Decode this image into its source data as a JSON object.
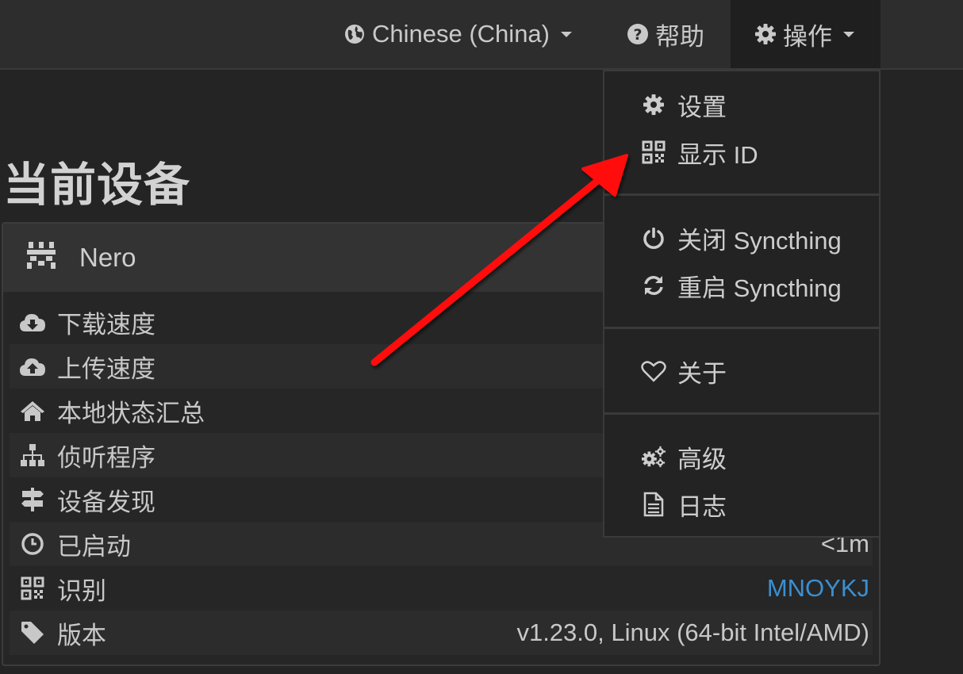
{
  "navbar": {
    "language": "Chinese (China)",
    "help": "帮助",
    "actions": "操作"
  },
  "page": {
    "title": "当前设备"
  },
  "device": {
    "name": "Nero",
    "rows": [
      {
        "icon": "cloud-download-icon",
        "label": "下载速度",
        "value": ""
      },
      {
        "icon": "cloud-upload-icon",
        "label": "上传速度",
        "value": ""
      },
      {
        "icon": "home-icon",
        "label": "本地状态汇总",
        "value": ""
      },
      {
        "icon": "sitemap-icon",
        "label": "侦听程序",
        "value": ""
      },
      {
        "icon": "signpost-icon",
        "label": "设备发现",
        "value": ""
      },
      {
        "icon": "clock-icon",
        "label": "已启动",
        "value": "<1m"
      },
      {
        "icon": "qrcode-icon",
        "label": "识别",
        "value": "MNOYKJ"
      },
      {
        "icon": "tag-icon",
        "label": "版本",
        "value": "v1.23.0, Linux (64-bit Intel/AMD)"
      }
    ]
  },
  "actions_menu": {
    "settings": "设置",
    "show_id": "显示 ID",
    "shutdown": "关闭 Syncthing",
    "restart": "重启 Syncthing",
    "about": "关于",
    "advanced": "高级",
    "logs": "日志"
  },
  "colors": {
    "accent_link": "#3b8fd0",
    "annotation_arrow": "#ff1010"
  }
}
